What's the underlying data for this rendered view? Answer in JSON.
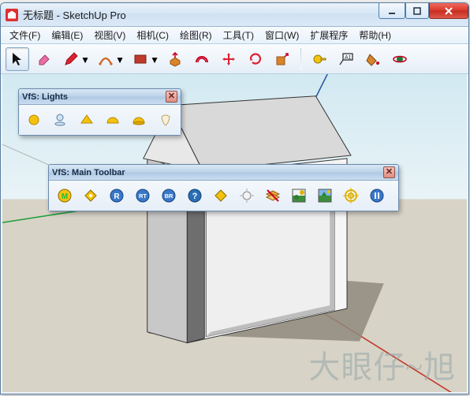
{
  "window": {
    "title": "无标题 - SketchUp Pro"
  },
  "menu": {
    "items": [
      {
        "label": "文件(F)"
      },
      {
        "label": "编辑(E)"
      },
      {
        "label": "视图(V)"
      },
      {
        "label": "相机(C)"
      },
      {
        "label": "绘图(R)"
      },
      {
        "label": "工具(T)"
      },
      {
        "label": "窗口(W)"
      },
      {
        "label": "扩展程序"
      },
      {
        "label": "帮助(H)"
      }
    ]
  },
  "toolbar": {
    "tools": [
      {
        "name": "select-tool",
        "hasDropdown": false,
        "active": true
      },
      {
        "name": "eraser-tool",
        "hasDropdown": false
      },
      {
        "name": "line-tool",
        "hasDropdown": true
      },
      {
        "name": "arc-tool",
        "hasDropdown": true
      },
      {
        "name": "rectangle-tool",
        "hasDropdown": true
      },
      {
        "name": "push-pull-tool",
        "hasDropdown": false
      },
      {
        "name": "offset-tool",
        "hasDropdown": false
      },
      {
        "name": "move-tool",
        "hasDropdown": false
      },
      {
        "name": "rotate-tool",
        "hasDropdown": false
      },
      {
        "name": "scale-tool",
        "hasDropdown": false
      }
    ],
    "measure": [
      {
        "name": "tape-measure-tool"
      },
      {
        "name": "text-label-tool"
      },
      {
        "name": "paint-bucket-tool"
      },
      {
        "name": "orbit-tool"
      }
    ]
  },
  "palettes": {
    "lights": {
      "title": "VfS: Lights",
      "items": [
        {
          "name": "omni-light"
        },
        {
          "name": "spot-light"
        },
        {
          "name": "rectangle-light"
        },
        {
          "name": "dome-light"
        },
        {
          "name": "sphere-light"
        },
        {
          "name": "ies-light"
        }
      ]
    },
    "main": {
      "title": "VfS: Main Toolbar",
      "items": [
        {
          "name": "material-editor",
          "letter": "M"
        },
        {
          "name": "option-editor"
        },
        {
          "name": "render",
          "letter": "R"
        },
        {
          "name": "render-rt",
          "letter": "RT"
        },
        {
          "name": "batch-render",
          "letter": "BR"
        },
        {
          "name": "help"
        },
        {
          "name": "frame-buffer"
        },
        {
          "name": "sun"
        },
        {
          "name": "overlay"
        },
        {
          "name": "camera"
        },
        {
          "name": "environment"
        },
        {
          "name": "focus"
        },
        {
          "name": "pause"
        }
      ]
    }
  },
  "colors": {
    "accent": "#d83a2c",
    "axis_red": "#c0392b",
    "axis_green": "#18a038",
    "axis_blue": "#2c5aa0",
    "ground": "#d6d1c5",
    "sky": "#cfe8f0"
  },
  "watermark": "大眼仔~旭"
}
